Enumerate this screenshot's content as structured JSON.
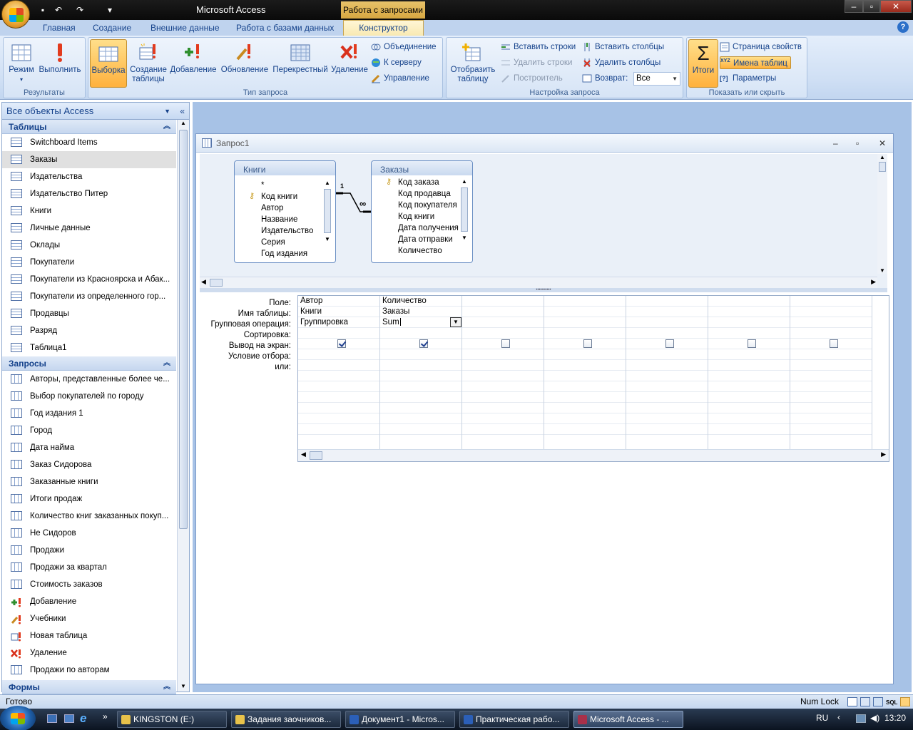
{
  "app": {
    "title": "Microsoft Access",
    "context_tab_title": "Работа с запросами",
    "qat_icons": [
      "save-icon",
      "undo-icon",
      "redo-icon",
      "customize-icon"
    ]
  },
  "tabs": [
    "Главная",
    "Создание",
    "Внешние данные",
    "Работа с базами данных"
  ],
  "active_tab": "Конструктор",
  "ribbon": {
    "results": {
      "label": "Результаты",
      "mode": "Режим",
      "run": "Выполнить"
    },
    "query_type": {
      "label": "Тип запроса",
      "select": "Выборка",
      "make_table_1": "Создание",
      "make_table_2": "таблицы",
      "append": "Добавление",
      "update": "Обновление",
      "crosstab": "Перекрестный",
      "delete": "Удаление",
      "union": "Объединение",
      "to_server": "К серверу",
      "manage": "Управление"
    },
    "query_setup": {
      "label": "Настройка запроса",
      "show_table_1": "Отобразить",
      "show_table_2": "таблицу",
      "insert_rows": "Вставить строки",
      "delete_rows": "Удалить строки",
      "builder": "Построитель",
      "insert_columns": "Вставить столбцы",
      "delete_columns": "Удалить столбцы",
      "return_label": "Возврат:",
      "return_value": "Все"
    },
    "show_hide": {
      "label": "Показать или скрыть",
      "totals": "Итоги",
      "property_sheet": "Страница свойств",
      "table_names": "Имена таблиц",
      "parameters": "Параметры"
    }
  },
  "nav": {
    "header": "Все объекты Access",
    "tables_header": "Таблицы",
    "tables": [
      "Switchboard Items",
      "Заказы",
      "Издательства",
      "Издательство Питер",
      "Книги",
      "Личные данные",
      "Оклады",
      "Покупатели",
      "Покупатели из Красноярска и Абак...",
      "Покупатели из определенного гор...",
      "Продавцы",
      "Разряд",
      "Таблица1"
    ],
    "queries_header": "Запросы",
    "queries": [
      "Авторы, представленные более че...",
      "Выбор покупателей по городу",
      "Год издания 1",
      "Город",
      "Дата найма",
      "Заказ Сидорова",
      "Заказанные книги",
      "Итоги продаж",
      "Количество книг заказанных покуп...",
      "Не Сидоров",
      "Продажи",
      "Продажи за квартал",
      "Стоимость заказов",
      "Добавление",
      "Учебники",
      "Новая таблица",
      "Удаление",
      "Продажи по авторам"
    ],
    "forms_header": "Формы"
  },
  "query_window": {
    "title": "Запрос1",
    "relation_one": "1",
    "relation_many": "∞",
    "table1": {
      "name": "Книги",
      "fields": [
        "*",
        "Код книги",
        "Автор",
        "Название",
        "Издательство",
        "Серия",
        "Год издания"
      ]
    },
    "table2": {
      "name": "Заказы",
      "fields": [
        "Код заказа",
        "Код продавца",
        "Код покупателя",
        "Код книги",
        "Дата получения",
        "Дата отправки",
        "Количество"
      ]
    },
    "row_labels": [
      "Поле:",
      "Имя таблицы:",
      "Групповая операция:",
      "Сортировка:",
      "Вывод на экран:",
      "Условие отбора:",
      "или:"
    ],
    "columns": [
      {
        "field": "Автор",
        "table": "Книги",
        "total": "Группировка",
        "show": true
      },
      {
        "field": "Количество",
        "table": "Заказы",
        "total": "Sum",
        "show": true
      },
      {
        "field": "",
        "table": "",
        "total": "",
        "show": false
      },
      {
        "field": "",
        "table": "",
        "total": "",
        "show": false
      },
      {
        "field": "",
        "table": "",
        "total": "",
        "show": false
      },
      {
        "field": "",
        "table": "",
        "total": "",
        "show": false
      },
      {
        "field": "",
        "table": "",
        "total": "",
        "show": false
      }
    ]
  },
  "status": {
    "left": "Готово",
    "numlock": "Num Lock"
  },
  "taskbar": {
    "items": [
      "KINGSTON (E:)",
      "Задания заочников...",
      "Документ1 - Micros...",
      "Практическая рабо...",
      "Microsoft Access - ..."
    ],
    "lang": "RU",
    "time": "13:20"
  }
}
